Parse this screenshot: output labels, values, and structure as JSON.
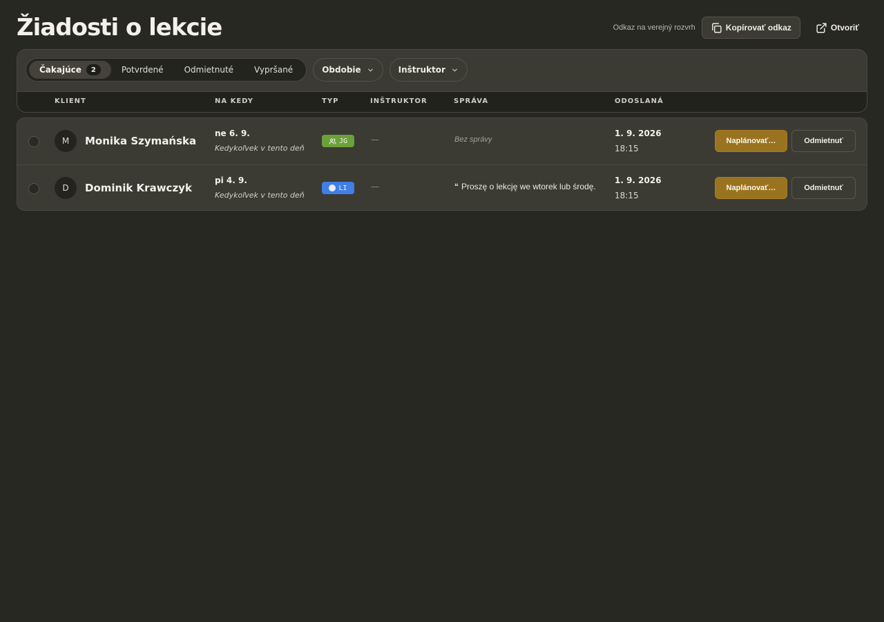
{
  "header": {
    "title": "Žiadosti o lekcie",
    "public_link_label": "Odkaz na verejný rozvrh",
    "copy_link_label": "Kopírovať odkaz",
    "open_label": "Otvoriť"
  },
  "tabs": [
    {
      "label": "Čakajúce",
      "count": "2",
      "active": true
    },
    {
      "label": "Potvrdené"
    },
    {
      "label": "Odmietnuté"
    },
    {
      "label": "Vypršané"
    }
  ],
  "filters": {
    "period_label": "Obdobie",
    "instructor_label": "Inštruktor"
  },
  "columns": {
    "client": "KLIENT",
    "when": "NA KEDY",
    "type": "TYP",
    "instructor": "INŠTRUKTOR",
    "message": "SPRÁVA",
    "sent": "ODOSLANÁ"
  },
  "rows": [
    {
      "initial": "M",
      "client": "Monika Szymańska",
      "when_date": "ne 6. 9.",
      "when_sub": "Kedykoľvek v tento deň",
      "type_code": "JG",
      "type_color": "#6aa13a",
      "type_icon": "users-icon",
      "instructor": "—",
      "message": "Bez správy",
      "sent_date": "1. 9. 2026",
      "sent_time": "18:15",
      "plan_label": "Naplánovať…",
      "reject_label": "Odmietnuť"
    },
    {
      "initial": "D",
      "client": "Dominik Krawczyk",
      "when_date": "pi 4. 9.",
      "when_sub": "Kedykoľvek v tento deň",
      "type_code": "LI",
      "type_color": "#3f7fe6",
      "type_icon": "dot-icon",
      "instructor": "—",
      "message_quote": "“",
      "message": "Proszę o lekcję we wtorek lub środę.",
      "sent_date": "1. 9. 2026",
      "sent_time": "18:15",
      "plan_label": "Naplánovať…",
      "reject_label": "Odmietnuť"
    }
  ]
}
